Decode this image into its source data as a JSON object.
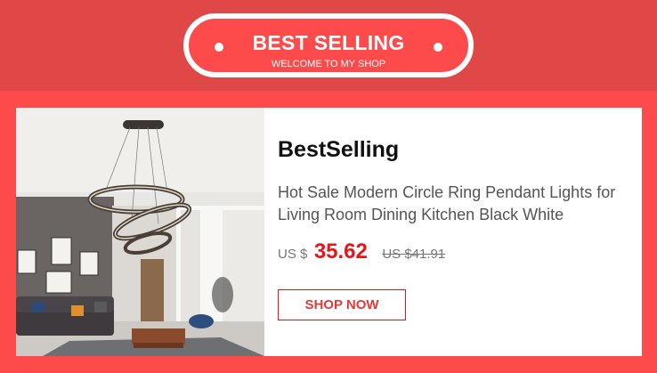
{
  "banner": {
    "title": "BEST SELLING",
    "subtitle": "WELCOME TO MY SHOP"
  },
  "product": {
    "name": "BestSelling",
    "description": "Hot Sale Modern Circle Ring Pendant Lights for Living Room Dining Kitchen Black White",
    "currency": "US $",
    "price": "35.62",
    "original_price": "US $41.91",
    "button_label": "SHOP NOW",
    "image_alt": "pendant-light-living-room-photo"
  },
  "colors": {
    "background": "#fd4b4b",
    "banner_band": "#e04848",
    "price": "#e8141a",
    "button_border": "#e8141a"
  }
}
